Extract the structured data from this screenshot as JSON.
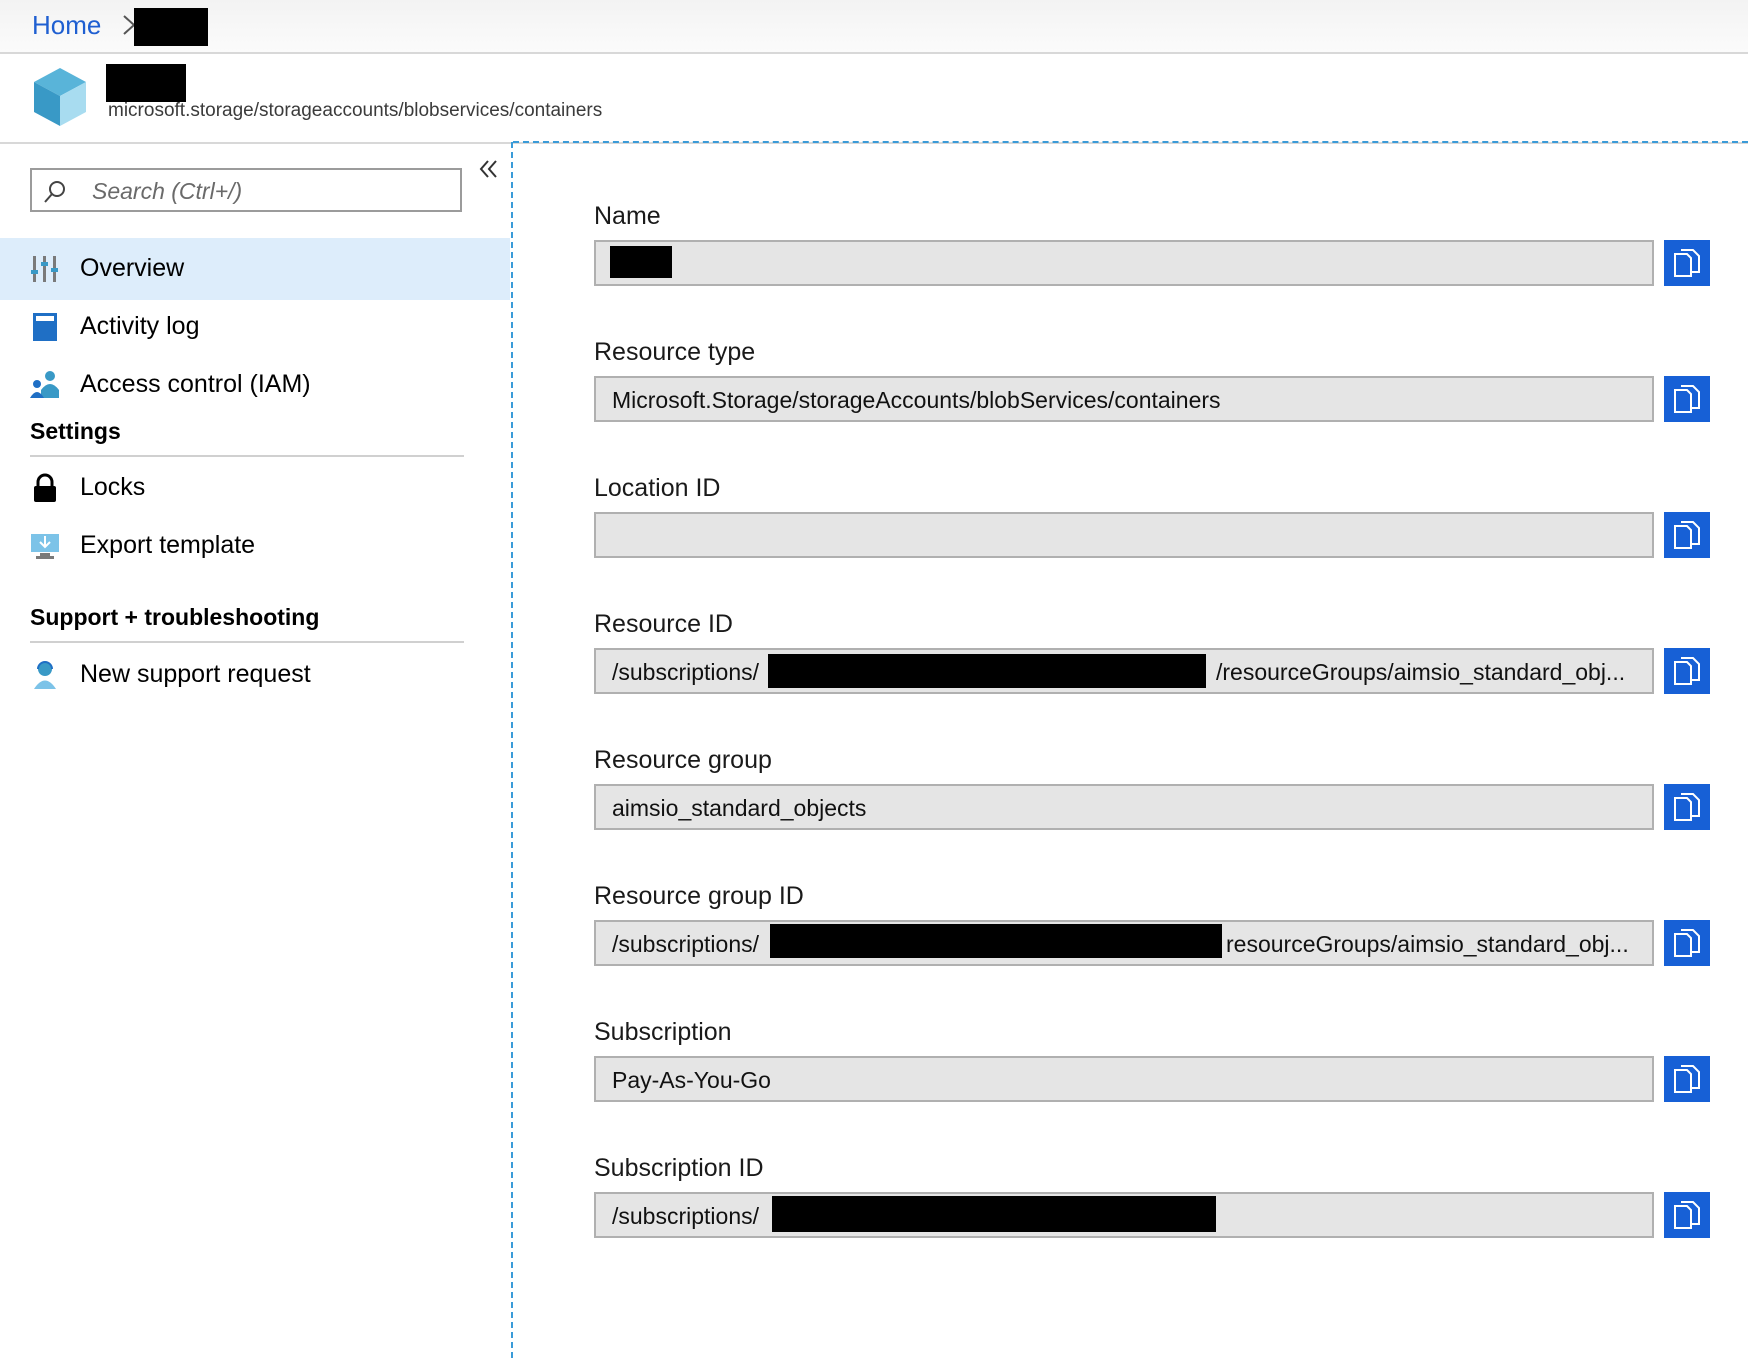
{
  "breadcrumb": {
    "home": "Home"
  },
  "header": {
    "resource_path": "microsoft.storage/storageaccounts/blobservices/containers"
  },
  "nav": {
    "search_placeholder": "Search (Ctrl+/)",
    "items": [
      {
        "label": "Overview",
        "icon": "overview-icon",
        "selected": true
      },
      {
        "label": "Activity log",
        "icon": "activity-log-icon"
      },
      {
        "label": "Access control (IAM)",
        "icon": "iam-icon"
      }
    ],
    "sections": [
      {
        "title": "Settings",
        "items": [
          {
            "label": "Locks",
            "icon": "lock-icon"
          },
          {
            "label": "Export template",
            "icon": "export-template-icon"
          }
        ]
      },
      {
        "title": "Support + troubleshooting",
        "items": [
          {
            "label": "New support request",
            "icon": "support-request-icon"
          }
        ]
      }
    ]
  },
  "fields": [
    {
      "label": "Name",
      "value": ""
    },
    {
      "label": "Resource type",
      "value": "Microsoft.Storage/storageAccounts/blobServices/containers"
    },
    {
      "label": "Location ID",
      "value": ""
    },
    {
      "label": "Resource ID",
      "value_prefix": "/subscriptions/",
      "value_suffix": "/resourceGroups/aimsio_standard_obj..."
    },
    {
      "label": "Resource group",
      "value": "aimsio_standard_objects"
    },
    {
      "label": "Resource group ID",
      "value_prefix": "/subscriptions/",
      "value_suffix": "resourceGroups/aimsio_standard_obj..."
    },
    {
      "label": "Subscription",
      "value": "Pay-As-You-Go"
    },
    {
      "label": "Subscription ID",
      "value_prefix": "/subscriptions/",
      "value_suffix": ""
    }
  ],
  "colors": {
    "accent": "#1760d6",
    "selected_bg": "#ddedfb",
    "link": "#1f5fd1",
    "divider": "#3a9bd8"
  }
}
